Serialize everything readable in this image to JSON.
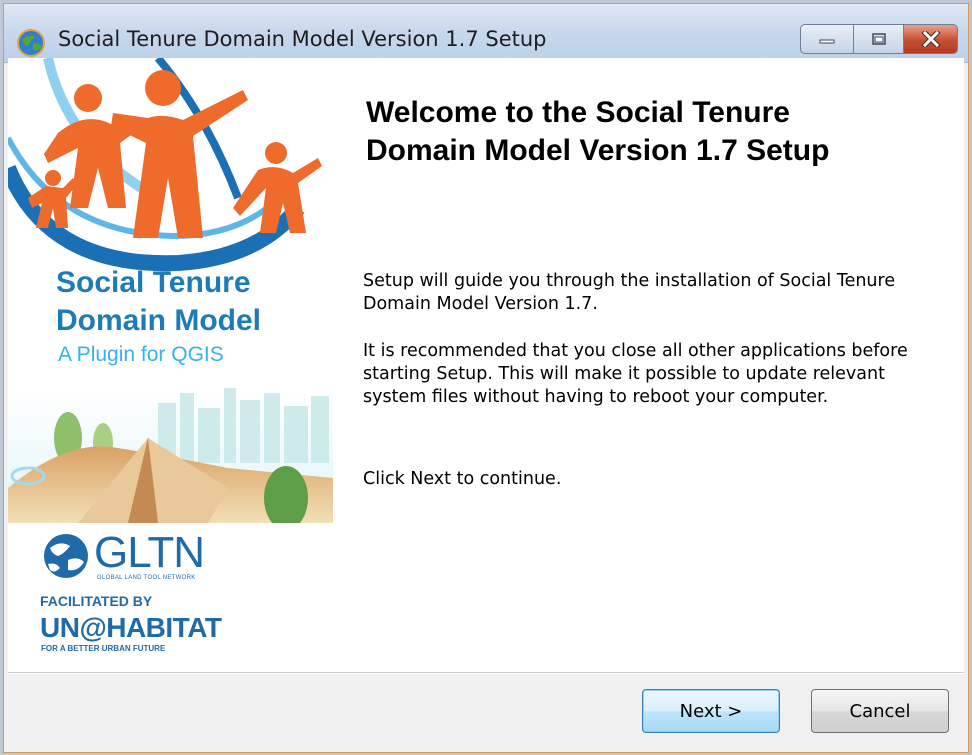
{
  "window": {
    "title": "Social Tenure Domain Model Version 1.7 Setup"
  },
  "sidebar": {
    "brand_line1": "Social Tenure",
    "brand_line2": "Domain Model",
    "brand_subtitle": "A Plugin for QGIS",
    "gltn_logo": "GLTN",
    "gltn_sub": "GLOBAL LAND TOOL NETWORK",
    "facilitated_by": "FACILITATED BY",
    "unhabitat_logo": "UN@HABITAT",
    "unhabitat_sub": "FOR A BETTER URBAN FUTURE"
  },
  "main": {
    "heading_line1": "Welcome to the Social Tenure",
    "heading_line2": "Domain Model Version 1.7 Setup",
    "paragraph1": "Setup will guide you through the installation of Social Tenure Domain Model Version 1.7.",
    "paragraph2": "It is recommended that you close all other applications before starting Setup. This will make it possible to update relevant system files without having to reboot your computer.",
    "paragraph3": "Click Next to continue."
  },
  "buttons": {
    "next": "Next >",
    "cancel": "Cancel"
  },
  "colors": {
    "brand_blue": "#1f7bb8",
    "brand_light_blue": "#35b3e8",
    "figure_orange": "#ee6b2c",
    "close_red": "#c74f36"
  }
}
